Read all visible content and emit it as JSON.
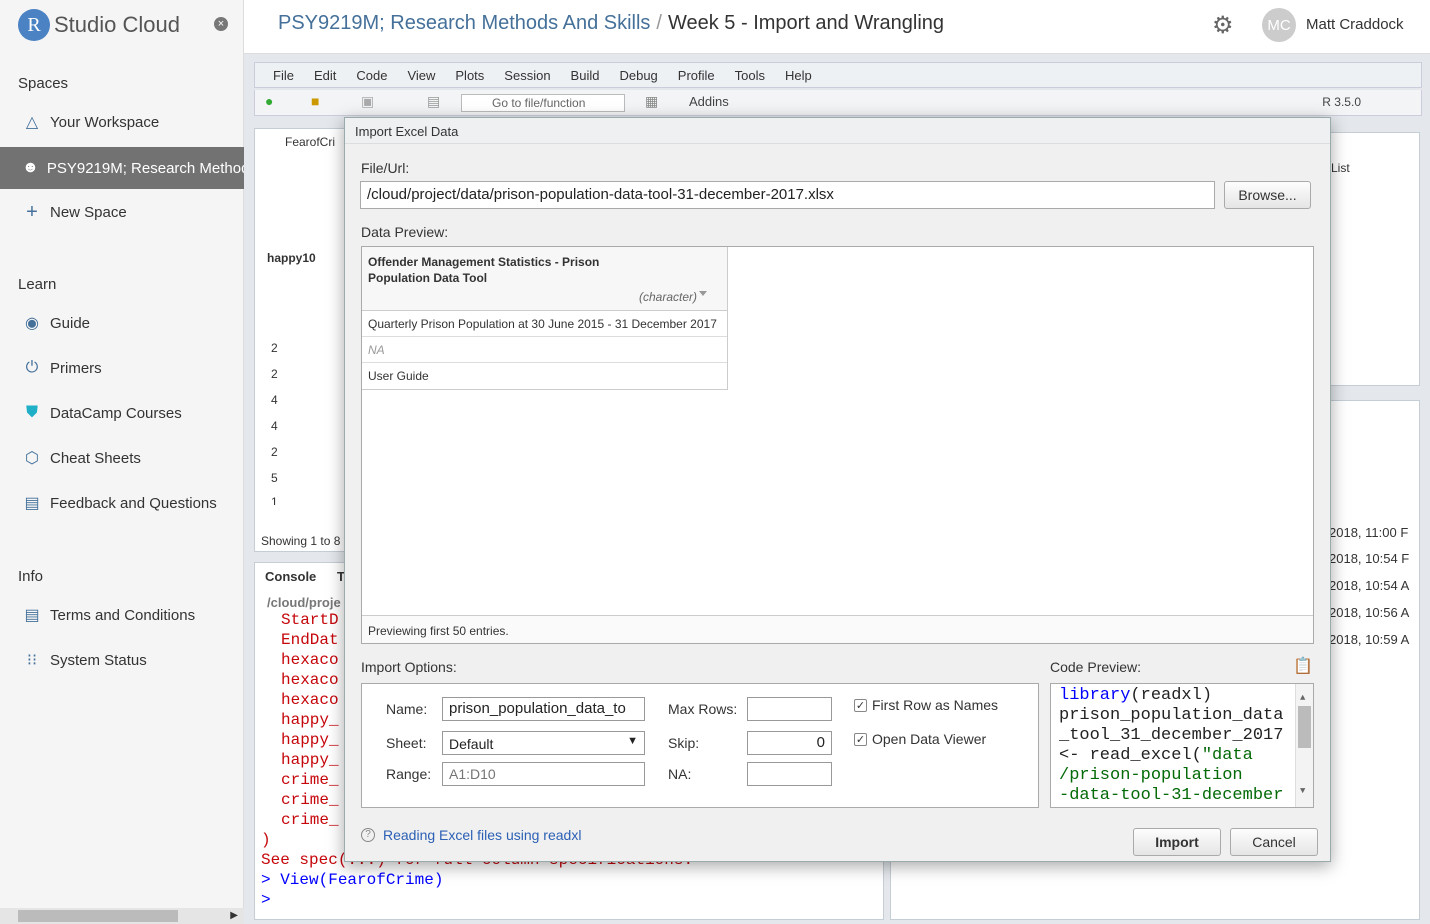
{
  "sidebar": {
    "logo_text": "Studio Cloud",
    "logo_letter": "R",
    "close_symbol": "×",
    "spaces_heading": "Spaces",
    "learn_heading": "Learn",
    "info_heading": "Info",
    "spaces": [
      {
        "label": "Your Workspace",
        "icon": "workspace-icon"
      },
      {
        "label": "PSY9219M; Research Methods And Skills",
        "icon": "people-icon",
        "active": true
      },
      {
        "label": "New Space",
        "icon": "plus-icon"
      }
    ],
    "learn": [
      {
        "label": "Guide",
        "icon": "compass-icon"
      },
      {
        "label": "Primers",
        "icon": "power-icon"
      },
      {
        "label": "DataCamp Courses",
        "icon": "shield-icon"
      },
      {
        "label": "Cheat Sheets",
        "icon": "hexagon-icon"
      },
      {
        "label": "Feedback and Questions",
        "icon": "chat-icon"
      }
    ],
    "info": [
      {
        "label": "Terms and Conditions",
        "icon": "document-icon"
      },
      {
        "label": "System Status",
        "icon": "pulse-icon"
      }
    ]
  },
  "header": {
    "space_link": "PSY9219M; Research Methods And Skills",
    "separator": "/",
    "project_title": "Week 5 - Import and Wrangling",
    "user_initials": "MC",
    "user_name": "Matt Craddock"
  },
  "ide": {
    "menu": [
      "File",
      "Edit",
      "Code",
      "View",
      "Plots",
      "Session",
      "Build",
      "Debug",
      "Profile",
      "Tools",
      "Help"
    ],
    "goto_placeholder": "Go to file/function",
    "addins_label": "Addins",
    "r_version": "R 3.5.0",
    "data_tab": "FearofCri",
    "column_header": "happy10",
    "column_values": [
      "2",
      "2",
      "4",
      "4",
      "2",
      "5",
      "1"
    ],
    "showing_text": "Showing 1 to 8",
    "console_tab": "Console",
    "console_tab2": "T",
    "console_path": "/cloud/proje",
    "console_lines": [
      "StartD",
      "EndDat",
      "hexaco",
      "hexaco",
      "hexaco",
      "happy_",
      "happy_",
      "happy_",
      "crime_",
      "crime_",
      "crime_"
    ],
    "console_close": ")",
    "console_spec": "See spec(...) for full column specifications.",
    "console_view": "> View(FearofCrime)",
    "console_prompt": ">",
    "env_list": "List",
    "history_times": [
      "2018, 11:00 F",
      "2018, 10:54 F",
      "2018, 10:54 A",
      "2018, 10:56 A",
      "2018, 10:59 A"
    ]
  },
  "dialog": {
    "title": "Import Excel Data",
    "file_label": "File/Url:",
    "file_path": "/cloud/project/data/prison-population-data-tool-31-december-2017.xlsx",
    "browse_label": "Browse...",
    "preview_label": "Data Preview:",
    "preview_column": "Offender Management Statistics - Prison Population Data Tool",
    "preview_type": "(character)",
    "preview_rows": [
      "Quarterly Prison Population at 30 June 2015 - 31 December 2017",
      "NA",
      "User Guide"
    ],
    "preview_footer": "Previewing first 50 entries.",
    "options_label": "Import Options:",
    "name_label": "Name:",
    "name_value": "prison_population_data_to",
    "sheet_label": "Sheet:",
    "sheet_value": "Default",
    "range_label": "Range:",
    "range_placeholder": "A1:D10",
    "maxrows_label": "Max Rows:",
    "maxrows_value": "",
    "skip_label": "Skip:",
    "skip_value": "0",
    "na_label": "NA:",
    "na_value": "",
    "first_row_label": "First Row as Names",
    "first_row_checked": true,
    "open_viewer_label": "Open Data Viewer",
    "open_viewer_checked": true,
    "code_label": "Code Preview:",
    "code_kw": "library",
    "code_l1_rest": "(readxl)",
    "code_l2": "prison_population_data",
    "code_l3": "_tool_31_december_2017",
    "code_l4_a": "<- read_excel(",
    "code_l4_b": "\"data",
    "code_l5": "/prison-population",
    "code_l6": "-data-tool-31-december",
    "help_link": "Reading Excel files using readxl",
    "import_label": "Import",
    "cancel_label": "Cancel"
  }
}
